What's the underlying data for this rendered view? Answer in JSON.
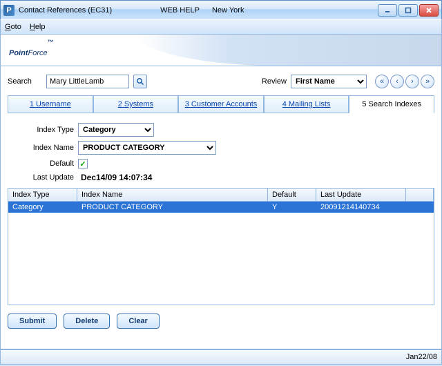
{
  "titlebar": {
    "app_icon_letter": "P",
    "title": "Contact References (EC31)",
    "webhelp": "WEB HELP",
    "location": "New York"
  },
  "menu": {
    "goto": "Goto",
    "help": "Help"
  },
  "branding": {
    "point": "Point",
    "force": "Force",
    "tm": "™"
  },
  "search": {
    "label": "Search",
    "value": "Mary LittleLamb",
    "review_label": "Review",
    "review_value": "First Name"
  },
  "tabs": {
    "t1": "1 Username",
    "t2": "2 Systems",
    "t3": "3 Customer Accounts",
    "t4": "4 Mailing Lists",
    "t5": "5 Search Indexes"
  },
  "form": {
    "index_type_label": "Index Type",
    "index_type_value": "Category",
    "index_name_label": "Index Name",
    "index_name_value": "PRODUCT CATEGORY",
    "default_label": "Default",
    "default_checked": "✓",
    "last_update_label": "Last Update",
    "last_update_value": "Dec14/09  14:07:34"
  },
  "grid": {
    "headers": {
      "c1": "Index Type",
      "c2": "Index Name",
      "c3": "Default",
      "c4": "Last Update"
    },
    "rows": [
      {
        "c1": "Category",
        "c2": "PRODUCT CATEGORY",
        "c3": "Y",
        "c4": "20091214140734"
      }
    ]
  },
  "buttons": {
    "submit": "Submit",
    "delete": "Delete",
    "clear": "Clear"
  },
  "statusbar": {
    "date": "Jan22/08"
  }
}
